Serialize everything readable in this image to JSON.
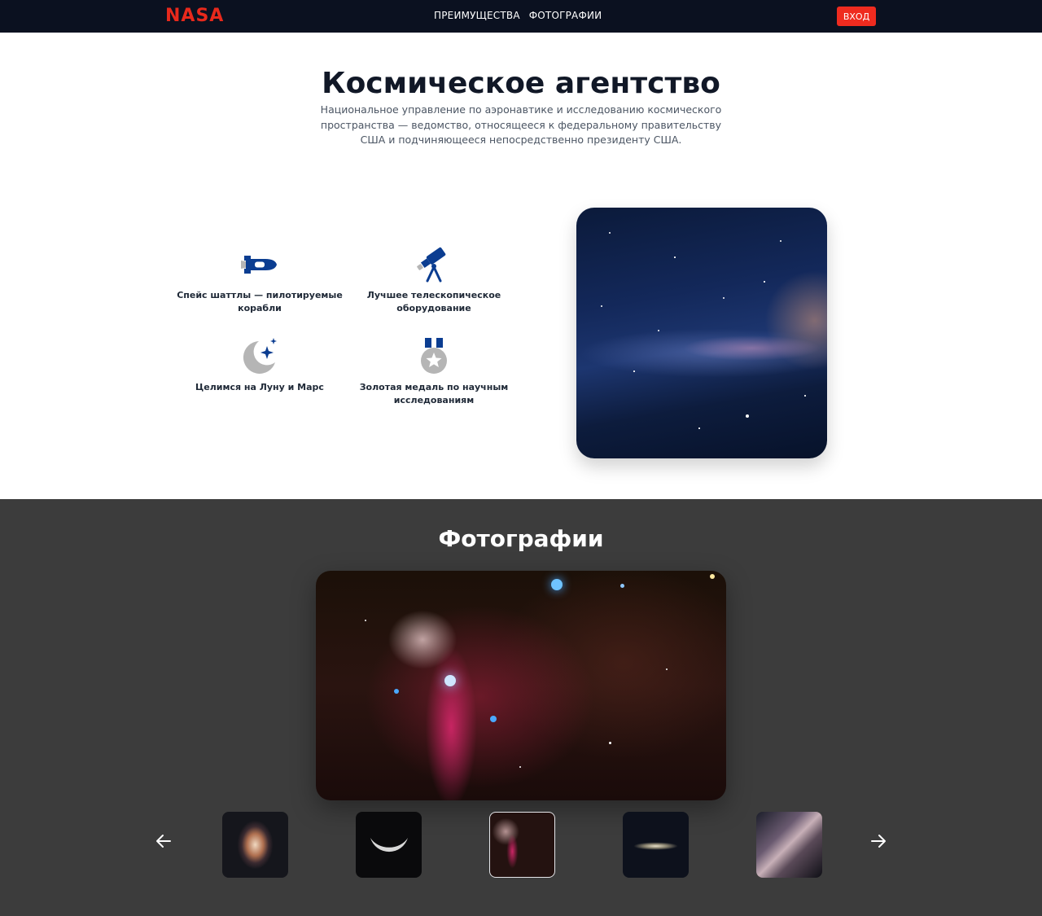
{
  "header": {
    "logo": "NASA",
    "nav": [
      {
        "label": "ПРЕИМУЩЕСТВА"
      },
      {
        "label": "ФОТОГРАФИИ"
      }
    ],
    "login_label": "ВХОД"
  },
  "hero": {
    "title": "Космическое агентство",
    "description": "Национальное управление по аэронавтике и исследованию космического пространства — ведомство, относящееся к федеральному правительству США и подчиняющееся непосредственно президенту США."
  },
  "features": [
    {
      "icon": "space-shuttle-icon",
      "label": "Спейс шаттлы — пилотируемые корабли"
    },
    {
      "icon": "telescope-icon",
      "label": "Лучшее телескопическое оборудование"
    },
    {
      "icon": "moon-stars-icon",
      "label": "Целимся на Луну и Марс"
    },
    {
      "icon": "medal-icon",
      "label": "Золотая медаль по научным исследованиям"
    }
  ],
  "photos": {
    "title": "Фотографии",
    "active_index": 2,
    "thumbnails": [
      "spiral-galaxy",
      "crescent-moon",
      "horsehead-nebula",
      "edge-on-galaxy",
      "milky-way"
    ]
  },
  "colors": {
    "header_bg": "#0b1120",
    "accent": "#ef2b1f",
    "icon_blue": "#0b3d91",
    "icon_gray": "#b5b5b5",
    "photos_bg": "#3c3c3c"
  }
}
